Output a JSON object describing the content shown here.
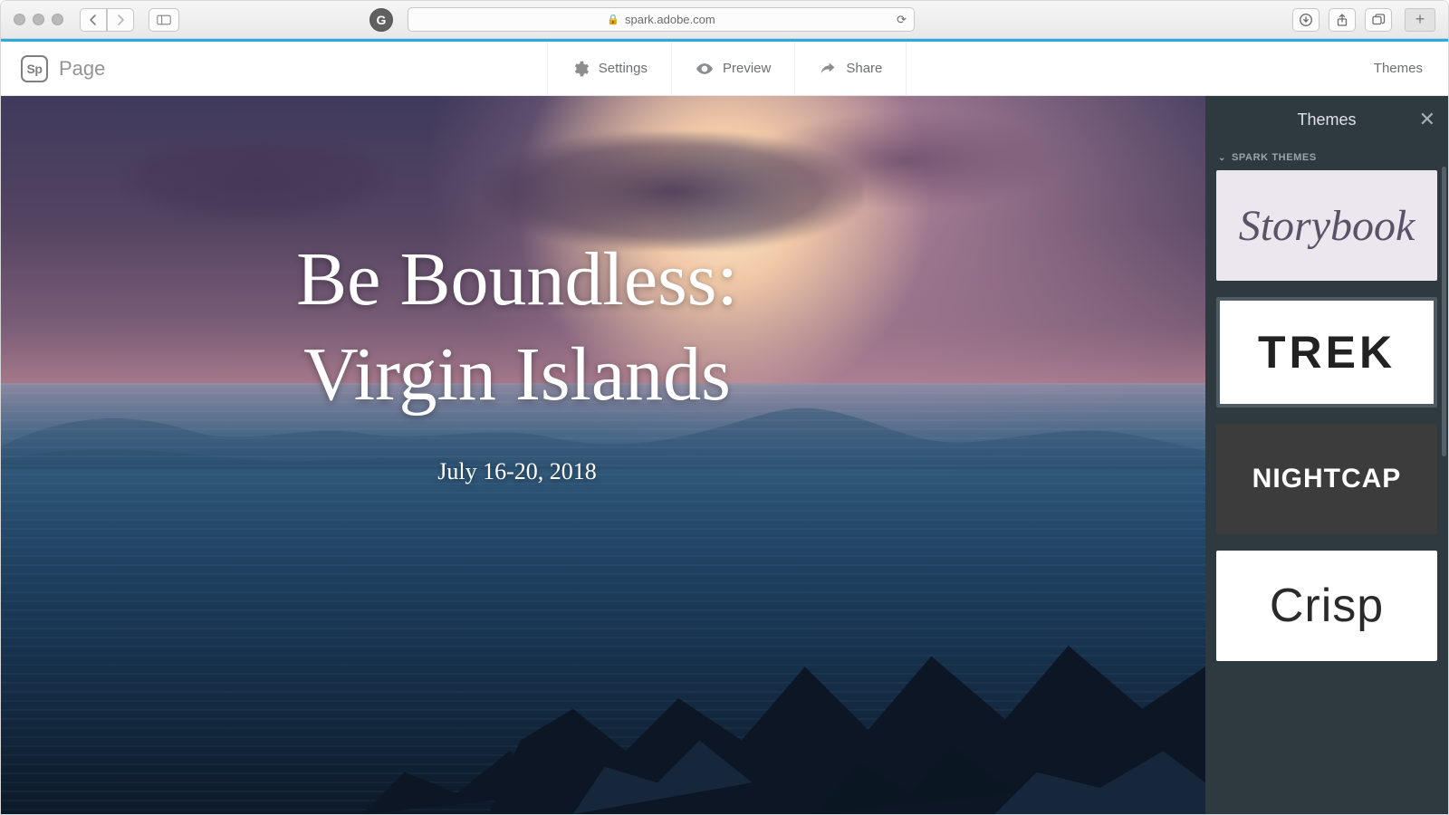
{
  "browser": {
    "url": "spark.adobe.com"
  },
  "app": {
    "brand_code": "Sp",
    "brand_name": "Page",
    "tools": {
      "settings": "Settings",
      "preview": "Preview",
      "share": "Share"
    },
    "themes_link": "Themes"
  },
  "canvas": {
    "title_line1": "Be Boundless:",
    "title_line2": "Virgin Islands",
    "subtitle": "July 16-20, 2018"
  },
  "panel": {
    "title": "Themes",
    "section": "SPARK THEMES",
    "themes": [
      {
        "name": "Storybook",
        "style": "storybook"
      },
      {
        "name": "TREK",
        "style": "trek"
      },
      {
        "name": "NIGHTCAP",
        "style": "nightcap"
      },
      {
        "name": "Crisp",
        "style": "crisp"
      }
    ]
  }
}
